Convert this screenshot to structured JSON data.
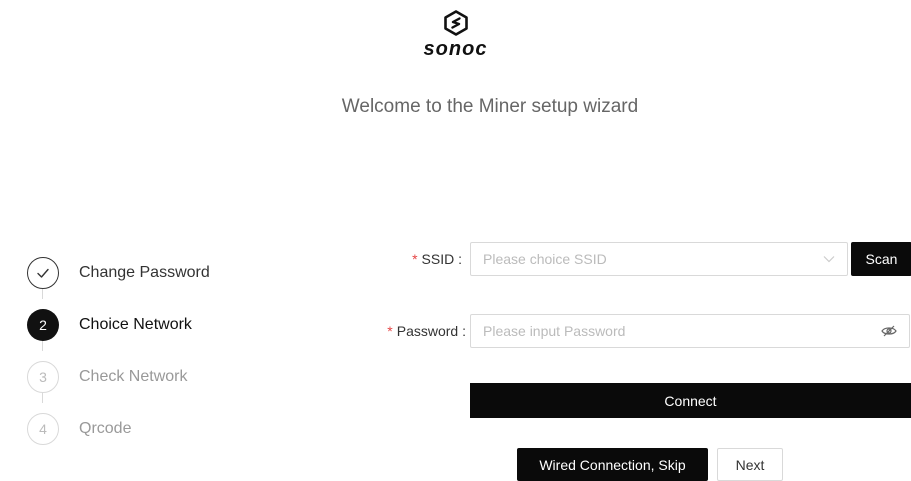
{
  "brand": {
    "name": "sonoc",
    "logo_icon": "sonoc-logo-icon"
  },
  "welcome_text": "Welcome to the Miner setup wizard",
  "steps": [
    {
      "number": "1",
      "label": "Change Password",
      "status": "done"
    },
    {
      "number": "2",
      "label": "Choice Network",
      "status": "active"
    },
    {
      "number": "3",
      "label": "Check Network",
      "status": "pending"
    },
    {
      "number": "4",
      "label": "Qrcode",
      "status": "pending"
    }
  ],
  "form": {
    "required_mark": "*",
    "ssid": {
      "label": "SSID",
      "placeholder": "Please choice SSID"
    },
    "password": {
      "label": "Password",
      "placeholder": "Please input Password"
    },
    "scan_label": "Scan",
    "connect_label": "Connect",
    "skip_label": "Wired Connection, Skip",
    "next_label": "Next"
  },
  "colors": {
    "accent": "#0a0a0a",
    "required": "#e54545",
    "border": "#d9d9d9",
    "placeholder": "#bbbbbb"
  }
}
